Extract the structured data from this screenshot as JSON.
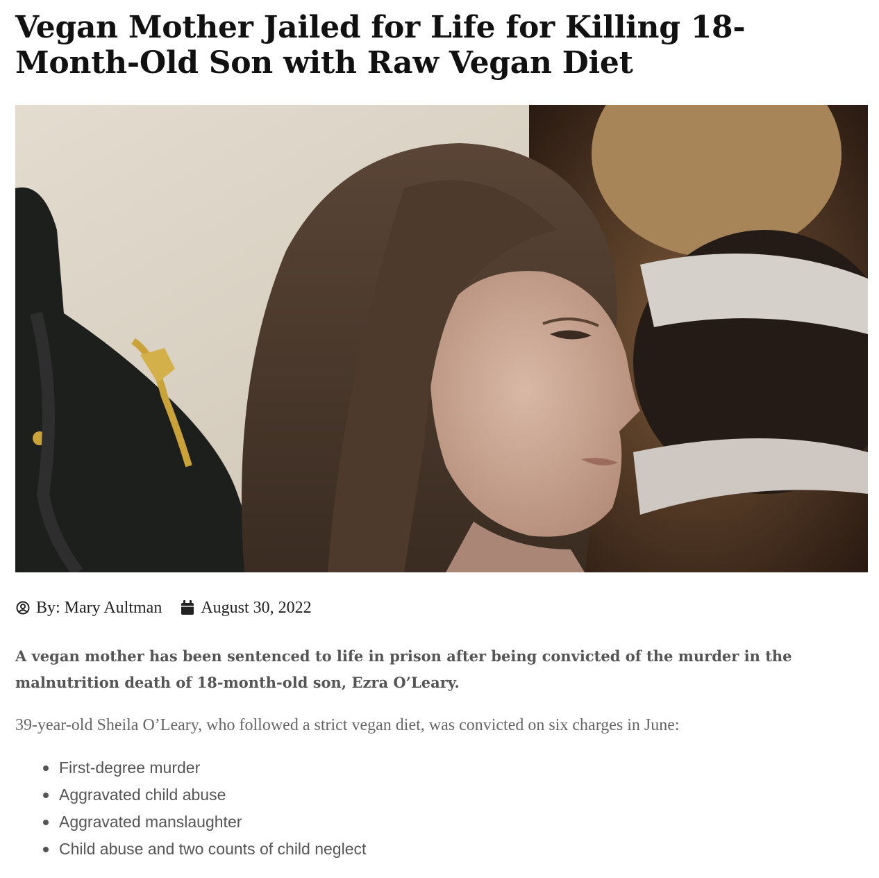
{
  "article": {
    "headline": "Vegan Mother Jailed for Life for Killing 18-Month-Old Son with Raw Vegan Diet",
    "hero_image": {
      "alt": "Sheila O'Leary in courtroom with officer behind her",
      "icon": "photo"
    },
    "meta": {
      "author_icon": "user-circle-icon",
      "author_label": "By: Mary Aultman",
      "date_icon": "calendar-icon",
      "date": "August 30, 2022"
    },
    "lead": "A vegan mother has been sentenced to life in prison after being convicted of the murder in the malnutrition death of 18-month-old son, Ezra O’Leary.",
    "paragraph": "39-year-old Sheila O’Leary, who followed a strict vegan diet, was convicted on six charges in June:",
    "charges": [
      "First-degree murder",
      "Aggravated child abuse",
      "Aggravated manslaughter",
      "Child abuse and two counts of child neglect"
    ]
  },
  "colors": {
    "headline": "#111111",
    "lead": "#555555",
    "body": "#666666"
  }
}
